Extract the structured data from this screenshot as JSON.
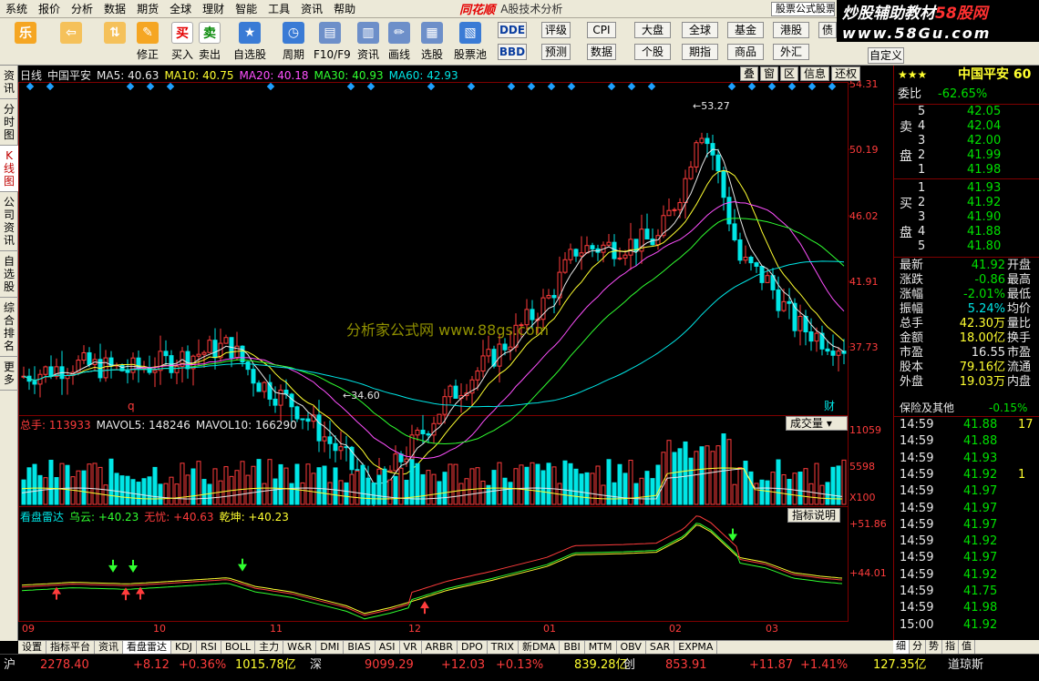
{
  "menu": [
    "系统",
    "报价",
    "分析",
    "数据",
    "期货",
    "全球",
    "理财",
    "智能",
    "工具",
    "资讯",
    "帮助"
  ],
  "brand": {
    "name": "同花顺",
    "sub": "A股技术分析",
    "promo": "股票公式股票"
  },
  "watermark": {
    "line1_pre": "炒股辅助教材",
    "line1_red": "58股网",
    "line2": "www.58Gu.com"
  },
  "toolbar": {
    "big_buttons": [
      {
        "id": "le",
        "label": "",
        "icon": "乐"
      },
      {
        "id": "back",
        "label": "",
        "icon": "⇦"
      },
      {
        "id": "updown",
        "label": "",
        "icon": "⇅"
      },
      {
        "id": "modify",
        "label": "修正",
        "icon": "✎"
      },
      {
        "id": "buy",
        "label": "买入",
        "icon": "买"
      },
      {
        "id": "sell",
        "label": "卖出",
        "icon": "卖"
      },
      {
        "id": "watch",
        "label": "自选股",
        "icon": "★"
      },
      {
        "id": "period",
        "label": "周期",
        "icon": "◷"
      },
      {
        "id": "f10",
        "label": "F10/F9",
        "icon": "▤"
      },
      {
        "id": "info",
        "label": "资讯",
        "icon": "▥"
      },
      {
        "id": "draw",
        "label": "画线",
        "icon": "✏"
      },
      {
        "id": "pick",
        "label": "选股",
        "icon": "▦"
      },
      {
        "id": "pool",
        "label": "股票池",
        "icon": "▧"
      }
    ],
    "small_buttons": [
      {
        "id": "dde",
        "label": "DDE",
        "style": "blue"
      },
      {
        "id": "rating",
        "label": "评级"
      },
      {
        "id": "cpi",
        "label": "CPI"
      },
      {
        "id": "bbd",
        "label": "BBD",
        "style": "blue"
      },
      {
        "id": "forecast",
        "label": "预测"
      },
      {
        "id": "data",
        "label": "数据"
      },
      {
        "id": "dapan",
        "label": "大盘"
      },
      {
        "id": "global",
        "label": "全球"
      },
      {
        "id": "fund",
        "label": "基金"
      },
      {
        "id": "hk",
        "label": "港股"
      },
      {
        "id": "bond",
        "label": "债"
      },
      {
        "id": "stock",
        "label": "个股"
      },
      {
        "id": "futures",
        "label": "期指"
      },
      {
        "id": "commodity",
        "label": "商品"
      },
      {
        "id": "fx",
        "label": "外汇"
      },
      {
        "id": "custom",
        "label": "自定义"
      }
    ]
  },
  "left_tabs": [
    {
      "label": "资讯"
    },
    {
      "label": "分时图"
    },
    {
      "label": "K线图",
      "active": true
    },
    {
      "label": "公司资讯"
    },
    {
      "label": "自选股"
    },
    {
      "label": "综合排名"
    },
    {
      "label": "更多"
    }
  ],
  "kline_header": {
    "period": "日线",
    "name": "中国平安",
    "ma": [
      {
        "label": "MA5: 40.63",
        "color": "#e8e8e8"
      },
      {
        "label": "MA10: 40.75",
        "color": "#ffff30"
      },
      {
        "label": "MA20: 40.18",
        "color": "#ff50ff"
      },
      {
        "label": "MA30: 40.93",
        "color": "#30ff30"
      },
      {
        "label": "MA60: 42.93",
        "color": "#00e6e6"
      }
    ],
    "buttons": [
      "叠",
      "窗",
      "区",
      "信息",
      "还权"
    ]
  },
  "price_axis": [
    "54.31",
    "50.19",
    "46.02",
    "41.91",
    "37.73"
  ],
  "hi_label": "53.27",
  "lo_label": "34.60",
  "chart_marks": {
    "q": "q",
    "cai": "财"
  },
  "watermark_text": "分析家公式网 www.88gs.com",
  "volume_header": {
    "lead": "总手: 113933",
    "items": [
      {
        "label": "MAVOL5: 148246",
        "color": "#e8e8e8"
      },
      {
        "label": "MAVOL10: 166290",
        "color": "#e8e8e8"
      }
    ],
    "button": "成交量",
    "axis": [
      "11059",
      "5598",
      "X100"
    ]
  },
  "indicator_header": {
    "lead": "看盘雷达",
    "items": [
      {
        "label": "乌云: +40.23",
        "color": "#30ff30"
      },
      {
        "label": "无忧: +40.63",
        "color": "#ff3c3c"
      },
      {
        "label": "乾坤: +40.23",
        "color": "#ffff30"
      }
    ],
    "button": "指标说明",
    "axis": [
      "+51.86",
      "+44.01"
    ]
  },
  "x_axis": [
    "09",
    "10",
    "11",
    "12",
    "01",
    "02",
    "03"
  ],
  "bottom_tabs": [
    {
      "label": "设置"
    },
    {
      "label": "指标平台"
    },
    {
      "label": "资讯"
    },
    {
      "label": "看盘雷达",
      "active": true
    },
    {
      "label": "KDJ"
    },
    {
      "label": "RSI"
    },
    {
      "label": "BOLL"
    },
    {
      "label": "主力"
    },
    {
      "label": "W&R"
    },
    {
      "label": "DMI"
    },
    {
      "label": "BIAS"
    },
    {
      "label": "ASI"
    },
    {
      "label": "VR"
    },
    {
      "label": "ARBR"
    },
    {
      "label": "DPO"
    },
    {
      "label": "TRIX"
    },
    {
      "label": "新DMA"
    },
    {
      "label": "BBI"
    },
    {
      "label": "MTM"
    },
    {
      "label": "OBV"
    },
    {
      "label": "SAR"
    },
    {
      "label": "EXPMA"
    }
  ],
  "right_panel": {
    "stars": "★★★",
    "name": "中国平安 60",
    "weibi": {
      "label": "委比",
      "value": "-62.65%"
    },
    "sell_label": [
      "卖",
      "盘"
    ],
    "sell": [
      {
        "lvl": "5",
        "price": "42.05"
      },
      {
        "lvl": "4",
        "price": "42.04"
      },
      {
        "lvl": "3",
        "price": "42.00"
      },
      {
        "lvl": "2",
        "price": "41.99"
      },
      {
        "lvl": "1",
        "price": "41.98"
      }
    ],
    "buy_label": [
      "买",
      "盘"
    ],
    "buy": [
      {
        "lvl": "1",
        "price": "41.93"
      },
      {
        "lvl": "2",
        "price": "41.92"
      },
      {
        "lvl": "3",
        "price": "41.90"
      },
      {
        "lvl": "4",
        "price": "41.88"
      },
      {
        "lvl": "5",
        "price": "41.80"
      }
    ],
    "stats": [
      {
        "k": "最新",
        "v": "41.92",
        "k2": "开盘",
        "vc": "g"
      },
      {
        "k": "涨跌",
        "v": "-0.86",
        "k2": "最高",
        "vc": "g"
      },
      {
        "k": "涨幅",
        "v": "-2.01%",
        "k2": "最低",
        "vc": "g"
      },
      {
        "k": "振幅",
        "v": "5.24%",
        "k2": "均价",
        "vc": "c"
      },
      {
        "k": "总手",
        "v": "42.30万",
        "k2": "量比",
        "vc": "y"
      },
      {
        "k": "金额",
        "v": "18.00亿",
        "k2": "换手",
        "vc": "y"
      },
      {
        "k": "市盈",
        "v": "16.55",
        "k2": "市盈",
        "vc": "w"
      },
      {
        "k": "股本",
        "v": "79.16亿",
        "k2": "流通",
        "vc": "y"
      },
      {
        "k": "外盘",
        "v": "19.03万",
        "k2": "内盘",
        "vc": "y"
      }
    ],
    "sector": {
      "label": "保险及其他",
      "value": "-0.15%"
    },
    "ticks": [
      {
        "t": "14:59",
        "p": "41.88",
        "v": "17"
      },
      {
        "t": "14:59",
        "p": "41.88",
        "v": ""
      },
      {
        "t": "14:59",
        "p": "41.93",
        "v": ""
      },
      {
        "t": "14:59",
        "p": "41.92",
        "v": "1"
      },
      {
        "t": "14:59",
        "p": "41.97",
        "v": ""
      },
      {
        "t": "14:59",
        "p": "41.97",
        "v": ""
      },
      {
        "t": "14:59",
        "p": "41.97",
        "v": ""
      },
      {
        "t": "14:59",
        "p": "41.92",
        "v": ""
      },
      {
        "t": "14:59",
        "p": "41.97",
        "v": ""
      },
      {
        "t": "14:59",
        "p": "41.92",
        "v": ""
      },
      {
        "t": "14:59",
        "p": "41.75",
        "v": ""
      },
      {
        "t": "14:59",
        "p": "41.98",
        "v": ""
      },
      {
        "t": "15:00",
        "p": "41.92",
        "v": ""
      }
    ],
    "tabs": [
      {
        "label": "细",
        "active": true
      },
      {
        "label": "分"
      },
      {
        "label": "势"
      },
      {
        "label": "指"
      },
      {
        "label": "值"
      }
    ]
  },
  "status_bar": [
    {
      "text": "沪",
      "c": "w"
    },
    {
      "text": "2278.40",
      "c": "r"
    },
    {
      "text": "+8.12",
      "c": "r"
    },
    {
      "text": "+0.36%",
      "c": "r"
    },
    {
      "text": "1015.78亿",
      "c": "y"
    },
    {
      "text": "深",
      "c": "w"
    },
    {
      "text": "9099.29",
      "c": "r"
    },
    {
      "text": "+12.03",
      "c": "r"
    },
    {
      "text": "+0.13%",
      "c": "r"
    },
    {
      "text": "839.28亿",
      "c": "y"
    },
    {
      "text": "创",
      "c": "w"
    },
    {
      "text": "853.91",
      "c": "r"
    },
    {
      "text": "+11.87",
      "c": "r"
    },
    {
      "text": "+1.41%",
      "c": "r"
    },
    {
      "text": "127.35亿",
      "c": "y"
    },
    {
      "text": "道琼斯",
      "c": "w"
    }
  ],
  "colors": {
    "up": "#ff3c3c",
    "down": "#00e6e6",
    "bg": "#000000",
    "panel": "#ece9d8",
    "grid": "#800000"
  }
}
